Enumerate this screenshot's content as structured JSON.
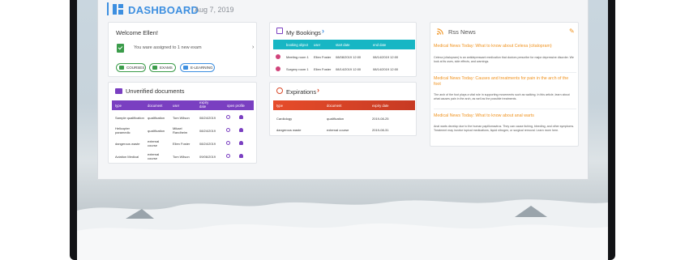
{
  "header": {
    "title": "DASHBOARD",
    "date": "Aug 7, 2019"
  },
  "welcome": {
    "title": "Welcome Ellen!",
    "assignment_text": "You ware assigned to 1 new exam",
    "chips": [
      "COURSES",
      "EXAMS",
      "E-LEARNING"
    ]
  },
  "unverified": {
    "title": "Unverified documents",
    "columns": [
      "type",
      "document",
      "user",
      "expiry date",
      "open profile"
    ],
    "rows": [
      {
        "type": "Sample qualification",
        "document": "qualification",
        "user": "Tom Wilson",
        "expiry": "08/24/2019"
      },
      {
        "type": "Helicopter paramedic",
        "document": "qualification",
        "user": "Mikael Randheim",
        "expiry": "08/24/2019"
      },
      {
        "type": "dangerous waste",
        "document": "external course",
        "user": "Ellen Foster",
        "expiry": "08/24/2019"
      },
      {
        "type": "Aviation Medical",
        "document": "external course",
        "user": "Tom Wilson",
        "expiry": "09/06/2019"
      }
    ]
  },
  "bookings": {
    "title": "My Bookings",
    "columns": [
      "booking object",
      "user",
      "start date",
      "end date"
    ],
    "rows": [
      {
        "object": "Meeting room 1",
        "user": "Ellen Foster",
        "start": "08/08/2019 12:00",
        "end": "08/14/2019 12:00"
      },
      {
        "object": "Surgery room 1",
        "user": "Ellen Foster",
        "start": "08/14/2019 12:00",
        "end": "08/14/2019 12:00"
      }
    ]
  },
  "expirations": {
    "title": "Expirations",
    "columns": [
      "type",
      "document",
      "expiry date"
    ],
    "rows": [
      {
        "type": "Cardiology",
        "document": "qualification",
        "expiry": "2019-08-25"
      },
      {
        "type": "dangerous waste",
        "document": "external course",
        "expiry": "2019-08-31"
      }
    ]
  },
  "rss": {
    "title": "Rss News",
    "items": [
      {
        "headline": "Medical News Today: What to know about Celexa (citalopram)",
        "body": "Celexa (citalopram) is an antidepressant medication that doctors prescribe for major depressive disorder. We look at its uses, side effects, and warnings."
      },
      {
        "headline": "Medical News Today: Causes and treatments for pain in the arch of the foot",
        "body": "The arch of the foot plays a vital role in supporting movements such as walking. In this article, learn about what causes pain in the arch, as well as the possible treatments."
      },
      {
        "headline": "Medical News Today: What to know about anal warts",
        "body": "Anal warts develop due to the human papillomavirus. They can cause itching, bleeding, and other symptoms. Treatment may involve topical medications, liquid nitrogen, or surgical removal. Learn more here."
      }
    ]
  },
  "colors": {
    "accent": "#3d8fe0",
    "purple": "#7a3fc1",
    "teal": "#17b6c4",
    "orange": "#f0921d",
    "red": "#e64c2a",
    "green": "#3b9c4a"
  }
}
